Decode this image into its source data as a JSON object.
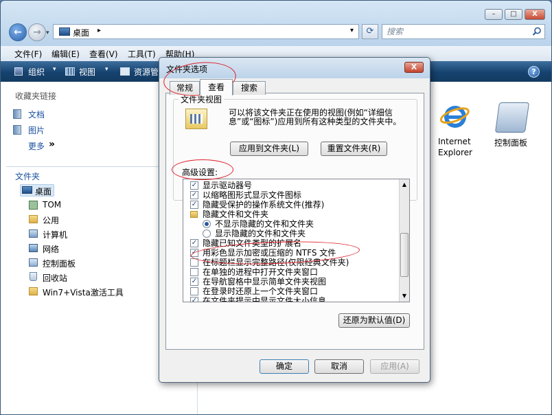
{
  "window": {
    "caption_buttons": {
      "minimize": "–",
      "maximize": "□",
      "close": "X"
    },
    "back_icon": "←",
    "forward_icon": "→",
    "address": {
      "location": "桌面",
      "arrow": "▸",
      "dropdown": "▾",
      "refresh_icon": "⟳"
    },
    "search": {
      "placeholder": "搜索"
    }
  },
  "menubar": [
    "文件(F)",
    "编辑(E)",
    "查看(V)",
    "工具(T)",
    "帮助(H)"
  ],
  "toolbar": {
    "organize": "组织",
    "views": "视图",
    "resources": "资源管",
    "help_icon": "?"
  },
  "left_pane": {
    "favorites_header": "收藏夹链接",
    "favorites": [
      "文档",
      "图片"
    ],
    "more": "更多",
    "more_icon": "»",
    "folders_header": "文件夹",
    "tree": [
      "桌面",
      "TOM",
      "公用",
      "计算机",
      "网络",
      "控制面板",
      "回收站",
      "Win7+Vista激活工具"
    ]
  },
  "content": {
    "items": [
      {
        "label1": "Internet",
        "label2": "Explorer"
      },
      {
        "label1": "控制面板",
        "label2": ""
      }
    ]
  },
  "dialog": {
    "title": "文件夹选项",
    "close_icon": "X",
    "tabs": [
      "常规",
      "查看",
      "搜索"
    ],
    "folder_view_group": "文件夹视图",
    "folder_view_desc": "可以将该文件夹正在使用的视图(例如“详细信息”或“图标”)应用到所有这种类型的文件夹中。",
    "apply_to_folders": "应用到文件夹(L)",
    "reset_folders": "重置文件夹(R)",
    "advanced_label": "高级设置:",
    "advanced_items": [
      {
        "text": "显示驱动器号",
        "kind": "check",
        "checked": true
      },
      {
        "text": "以缩略图形式显示文件图标",
        "kind": "check",
        "checked": true
      },
      {
        "text": "隐藏受保护的操作系统文件(推荐)",
        "kind": "check",
        "checked": true
      },
      {
        "text": "隐藏文件和文件夹",
        "kind": "folder",
        "checked": false
      },
      {
        "text": "不显示隐藏的文件和文件夹",
        "kind": "radio",
        "checked": true
      },
      {
        "text": "显示隐藏的文件和文件夹",
        "kind": "radio",
        "checked": false
      },
      {
        "text": "隐藏已知文件类型的扩展名",
        "kind": "check",
        "checked": true
      },
      {
        "text": "用彩色显示加密或压缩的 NTFS 文件",
        "kind": "check",
        "checked": true
      },
      {
        "text": "在标题栏显示完整路径(仅限经典文件夹)",
        "kind": "check",
        "checked": false
      },
      {
        "text": "在单独的进程中打开文件夹窗口",
        "kind": "check",
        "checked": false
      },
      {
        "text": "在导航窗格中显示简单文件夹视图",
        "kind": "check",
        "checked": true
      },
      {
        "text": "在登录时还原上一个文件夹窗口",
        "kind": "check",
        "checked": false
      },
      {
        "text": "在文件夹提示中显示文件大小信息",
        "kind": "check",
        "checked": true
      }
    ],
    "restore_defaults": "还原为默认值(D)",
    "ok": "确定",
    "cancel": "取消",
    "apply": "应用(A)"
  },
  "colors": {
    "annotation": "#e0202a",
    "toolbar": "#15426f",
    "link": "#1a50a0"
  }
}
